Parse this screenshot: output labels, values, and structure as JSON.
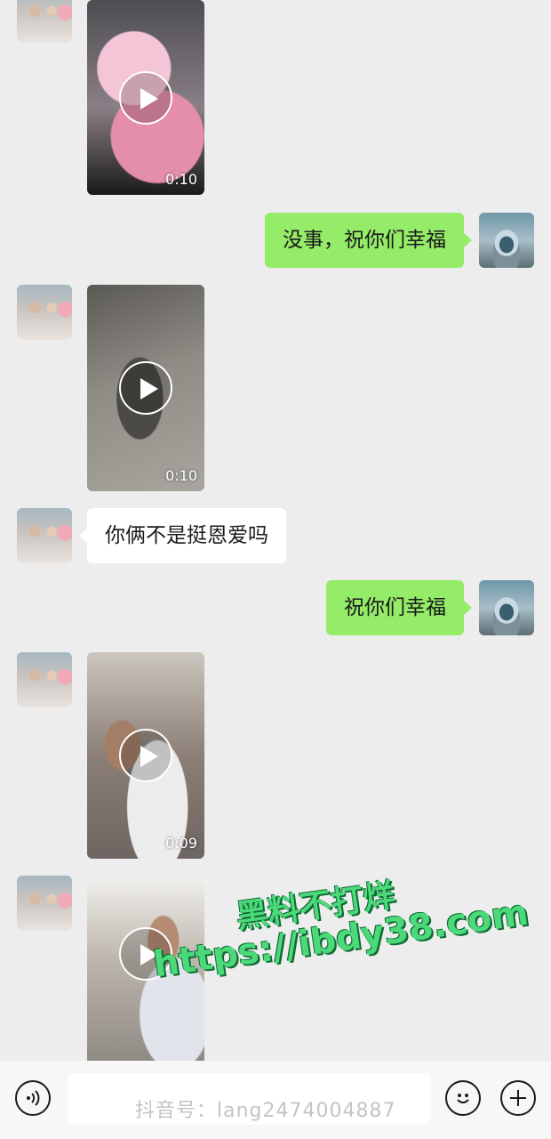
{
  "messages": [
    {
      "type": "video",
      "from": "contact",
      "duration": "0:10"
    },
    {
      "type": "text",
      "from": "me",
      "text": "没事，祝你们幸福"
    },
    {
      "type": "video",
      "from": "contact",
      "duration": "0:10"
    },
    {
      "type": "text",
      "from": "contact",
      "text": "你俩不是挺恩爱吗"
    },
    {
      "type": "text",
      "from": "me",
      "text": "祝你们幸福"
    },
    {
      "type": "video",
      "from": "contact",
      "duration": "0:09"
    },
    {
      "type": "video",
      "from": "contact",
      "duration": ""
    }
  ],
  "watermark": {
    "line1": "黑料不打烊",
    "line2": "https://ibdy38.com",
    "source": "抖音号：lang2474004887"
  },
  "input_bar": {
    "voice_icon": "voice-icon",
    "emoji_icon": "emoji-icon",
    "plus_icon": "plus-icon"
  },
  "colors": {
    "background": "#ededed",
    "sent_bubble": "#95ec69",
    "received_bubble": "#ffffff",
    "watermark_green": "#4cd97a"
  }
}
